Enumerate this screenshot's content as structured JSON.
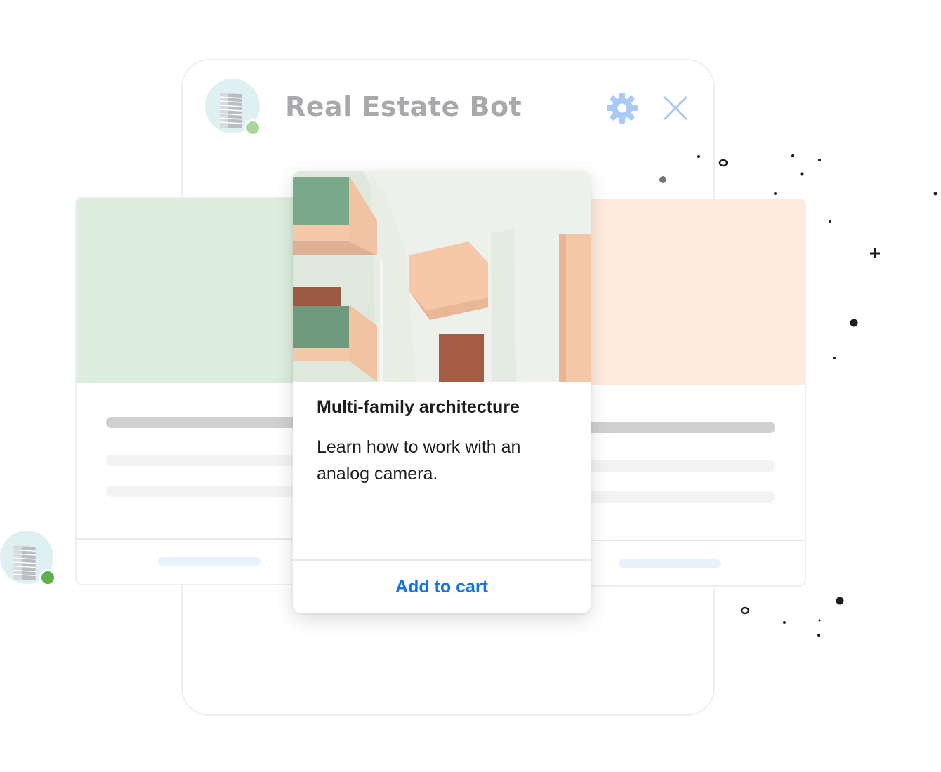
{
  "bot": {
    "name": "Real Estate Bot",
    "status_color": "#a9d69a",
    "settings_icon": "gear-icon",
    "close_icon": "close-icon"
  },
  "carousel": {
    "left_card": {
      "hero_color": "#deeede"
    },
    "right_card": {
      "hero_color": "#feebdc"
    },
    "main_card": {
      "title": "Multi-family architecture",
      "description": "Learn how to work with an analog camera.",
      "button_label": "Add to cart"
    }
  },
  "message_avatar": {
    "status_color": "#5fb04a"
  },
  "colors": {
    "accent": "#1273e6",
    "gear": "#a9c9f7"
  }
}
